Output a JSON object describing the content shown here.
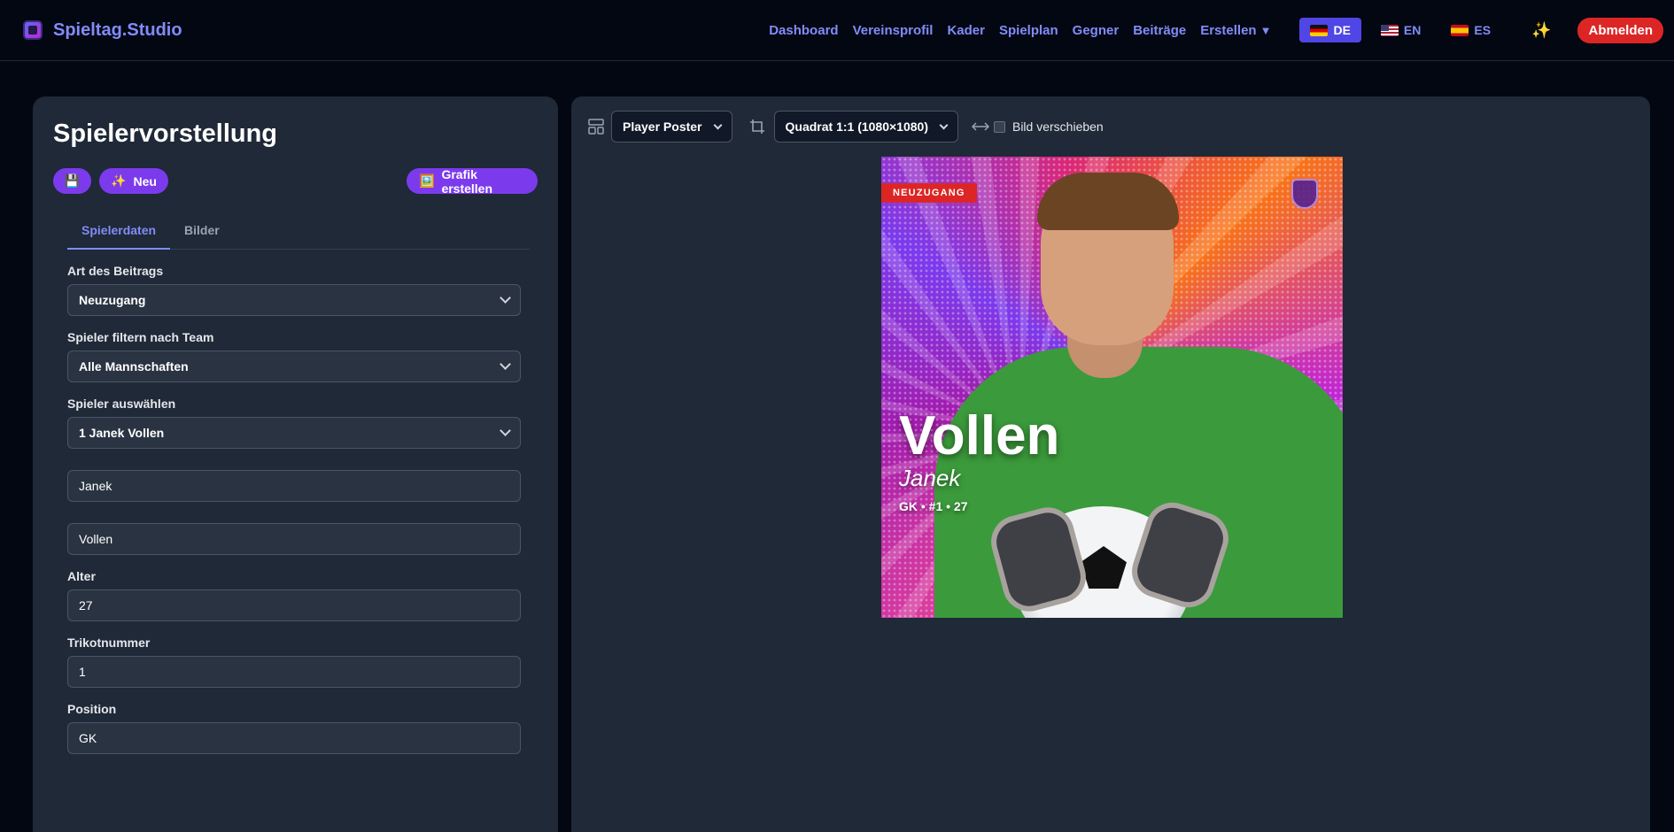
{
  "brand": {
    "name": "Spieltag.Studio"
  },
  "nav": {
    "links": [
      "Dashboard",
      "Vereinsprofil",
      "Kader",
      "Spielplan",
      "Gegner",
      "Beiträge"
    ],
    "create_label": "Erstellen",
    "create_caret": "▼",
    "languages": [
      {
        "code": "DE",
        "flag": "flag-de",
        "active": true
      },
      {
        "code": "EN",
        "flag": "flag-en",
        "active": false
      },
      {
        "code": "ES",
        "flag": "flag-es",
        "active": false
      }
    ],
    "sparkle": "✨",
    "logout_label": "Abmelden"
  },
  "left": {
    "title": "Spielervorstellung",
    "save_icon": "💾",
    "new_icon": "✨",
    "new_label": "Neu",
    "grafik_icon": "🖼️",
    "grafik_label": "Grafik erstellen",
    "tabs": [
      "Spielerdaten",
      "Bilder"
    ],
    "form": {
      "post_type_label": "Art des Beitrags",
      "post_type_value": "Neuzugang",
      "team_filter_label": "Spieler filtern nach Team",
      "team_filter_value": "Alle Mannschaften",
      "player_select_label": "Spieler auswählen",
      "player_select_value": "1 Janek Vollen",
      "first_name": "Janek",
      "last_name": "Vollen",
      "age_label": "Alter",
      "age_value": "27",
      "jersey_label": "Trikotnummer",
      "jersey_value": "1",
      "position_label": "Position",
      "position_value": "GK"
    }
  },
  "right": {
    "template_value": "Player Poster",
    "format_value": "Quadrat 1:1 (1080×1080)",
    "move_label": "Bild verschieben",
    "poster": {
      "tag": "NEUZUGANG",
      "last_name": "Vollen",
      "first_name": "Janek",
      "meta": "GK • #1 • 27"
    }
  },
  "colors": {
    "accent": "#818cf8",
    "primary_button": "#7c3aed",
    "active_lang": "#4f46e5",
    "logout": "#dc2626",
    "panel": "#1f2937",
    "background": "#030712"
  }
}
